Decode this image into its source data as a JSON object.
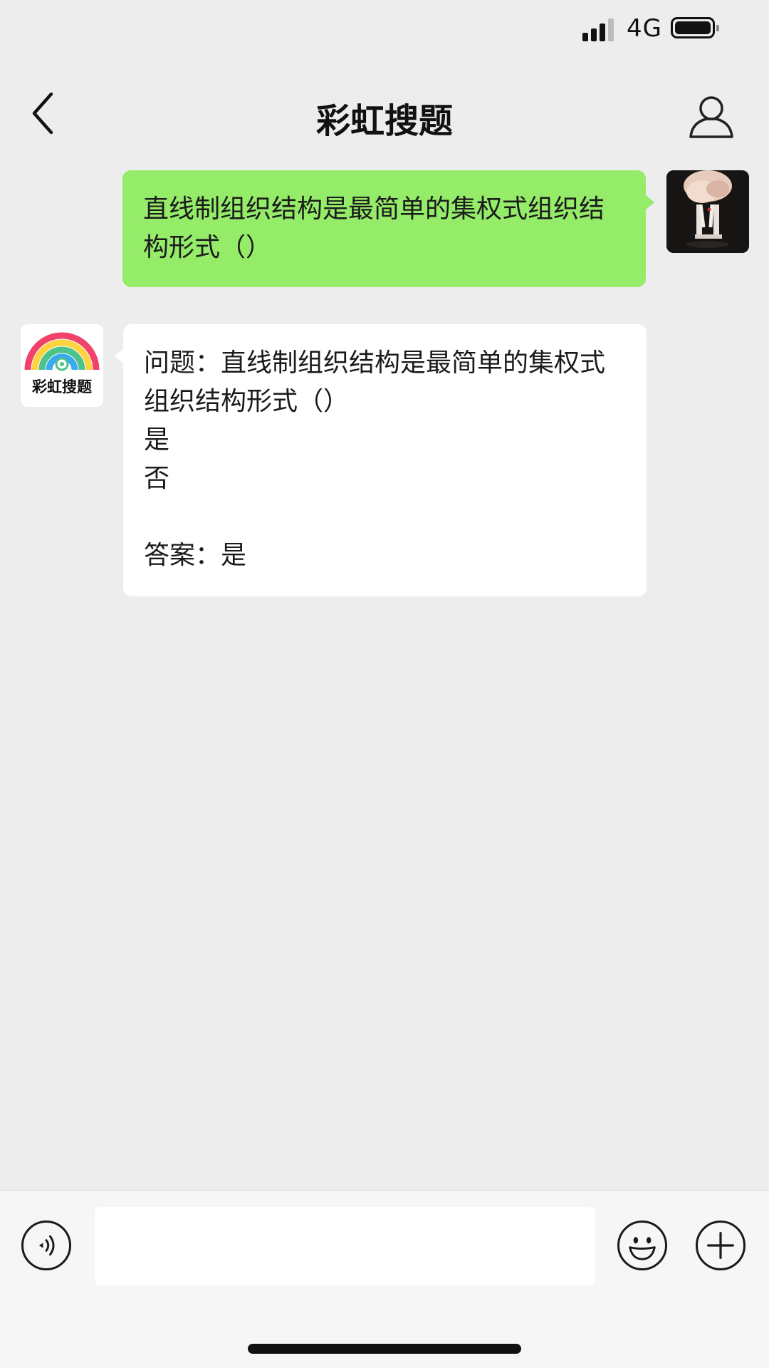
{
  "status_bar": {
    "network": "4G",
    "battery_level": 1.0
  },
  "nav": {
    "title": "彩虹搜题"
  },
  "bot": {
    "avatar_label": "彩虹搜题"
  },
  "messages": {
    "sent": {
      "lines": [
        "直线制组织结构是最简单的集权式组织结",
        "构形式（）"
      ]
    },
    "received": {
      "lines": [
        "问题：直线制组织结构是最简单的集权式",
        "组织结构形式（）",
        "是",
        "否",
        "",
        "答案：是"
      ]
    }
  },
  "input": {
    "value": "",
    "placeholder": ""
  },
  "icons": {
    "back": "chevron-left-icon",
    "profile": "person-icon",
    "voice": "voice-icon",
    "emoji": "smile-icon",
    "plus": "plus-icon"
  },
  "colors": {
    "background": "#ededed",
    "sent_bubble": "#95ec69",
    "received_bubble": "#ffffff",
    "input_bar": "#f6f6f6"
  }
}
